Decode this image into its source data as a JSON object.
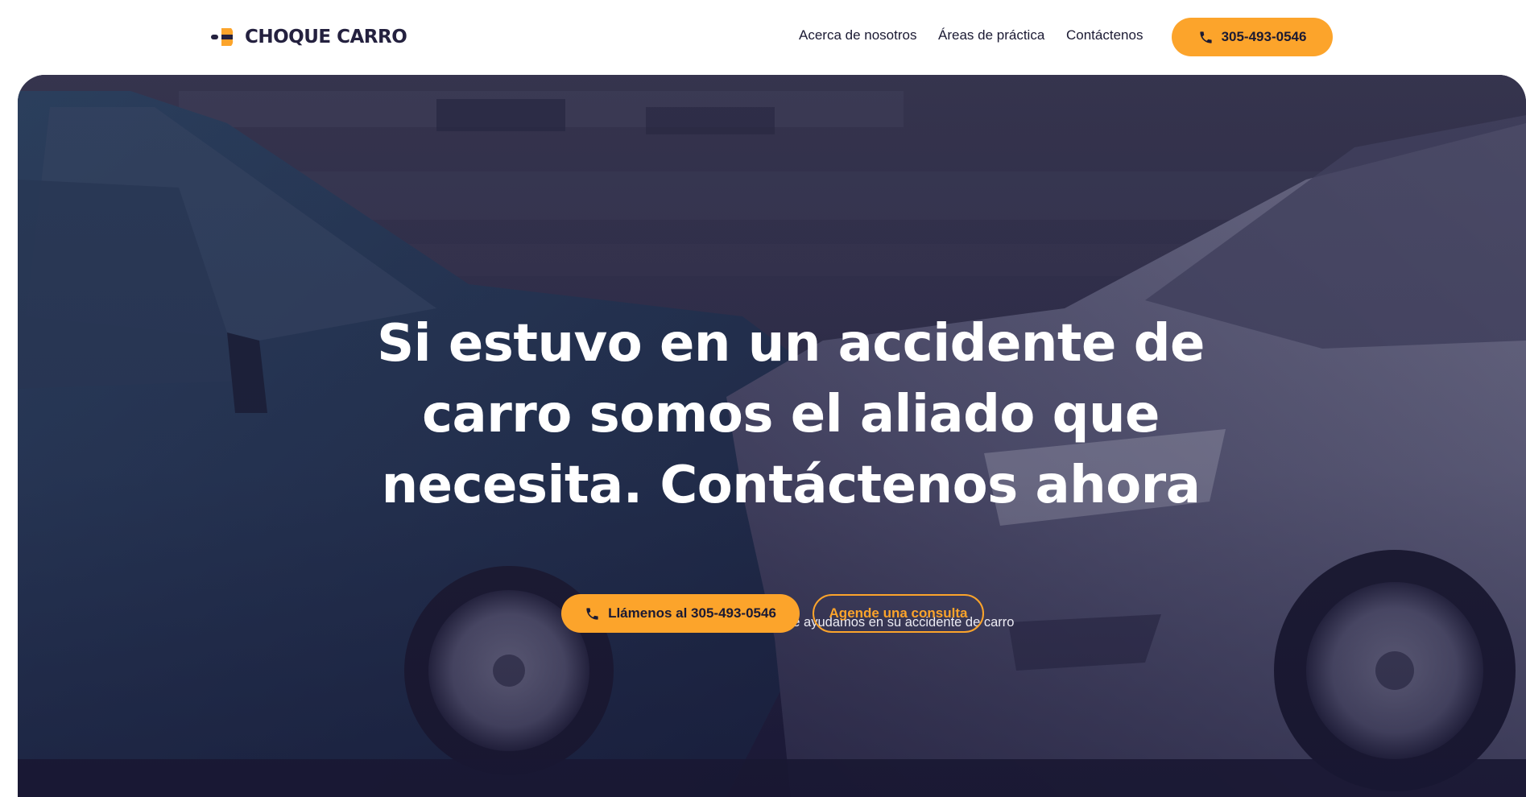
{
  "brand": {
    "name": "CHOQUE CARRO",
    "logo_icon": "brand-c-mark"
  },
  "nav": {
    "about": "Acerca de nosotros",
    "practice_areas": "Áreas de práctica",
    "contact": "Contáctenos",
    "phone": "305-493-0546",
    "phone_icon": "phone-icon"
  },
  "hero": {
    "background": "photo of two damaged cars after a head-on collision on a wet street",
    "title": "Si estuvo en un accidente de carro somos el aliado que necesita. Contáctenos ahora",
    "subtitle": "Reciba su consulta gratuita, nosotros le ayudamos en su accidente de carro",
    "call_button": "Llámenos al 305-493-0546",
    "consult_button": "Agende una consulta"
  },
  "colors": {
    "accent": "#fca42b",
    "navy": "#24213f",
    "overlay": "#1f1d40",
    "white": "#ffffff"
  }
}
